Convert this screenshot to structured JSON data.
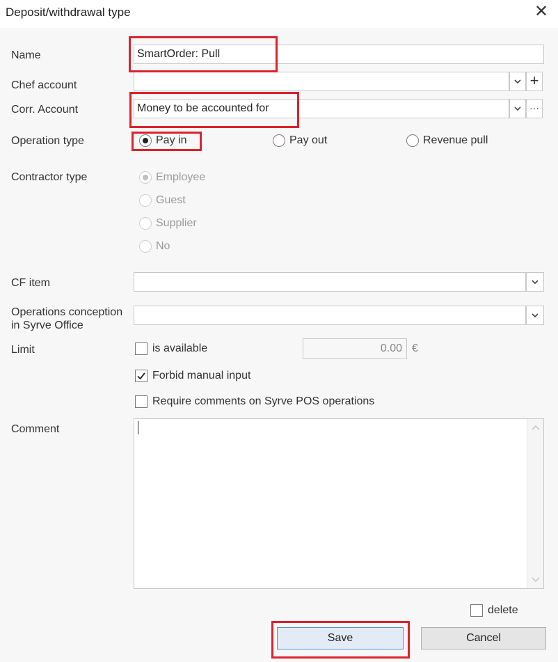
{
  "window": {
    "title": "Deposit/withdrawal type",
    "close_glyph": "✕"
  },
  "form": {
    "name": {
      "label": "Name",
      "value": "SmartOrder: Pull"
    },
    "chef_account": {
      "label": "Chef account",
      "value": "",
      "add_glyph": "+"
    },
    "corr_account": {
      "label": "Corr. Account",
      "value": "Money to be accounted for",
      "more_glyph": "···"
    },
    "operation_type": {
      "label": "Operation type",
      "options": [
        {
          "label": "Pay in",
          "selected": true
        },
        {
          "label": "Pay out",
          "selected": false
        },
        {
          "label": "Revenue pull",
          "selected": false
        }
      ]
    },
    "contractor_type": {
      "label": "Contractor type",
      "disabled": true,
      "options": [
        {
          "label": "Employee",
          "selected": true
        },
        {
          "label": "Guest",
          "selected": false
        },
        {
          "label": "Supplier",
          "selected": false
        },
        {
          "label": "No",
          "selected": false
        }
      ]
    },
    "cf_item": {
      "label": "CF item",
      "value": ""
    },
    "operations_conception": {
      "label_line1": "Operations conception",
      "label_line2": "in Syrve Office",
      "value": ""
    },
    "limit": {
      "label": "Limit",
      "is_available_label": "is available",
      "is_available_checked": false,
      "amount": "0.00",
      "currency": "€"
    },
    "forbid_manual_input": {
      "label": "Forbid manual input",
      "checked": true
    },
    "require_comments": {
      "label": "Require comments on Syrve POS operations",
      "checked": false
    },
    "comment": {
      "label": "Comment",
      "value": ""
    },
    "delete": {
      "label": "delete",
      "checked": false
    }
  },
  "buttons": {
    "save": "Save",
    "cancel": "Cancel"
  },
  "colors": {
    "highlight": "#d9232d",
    "primary_border": "#4a8fd6"
  }
}
